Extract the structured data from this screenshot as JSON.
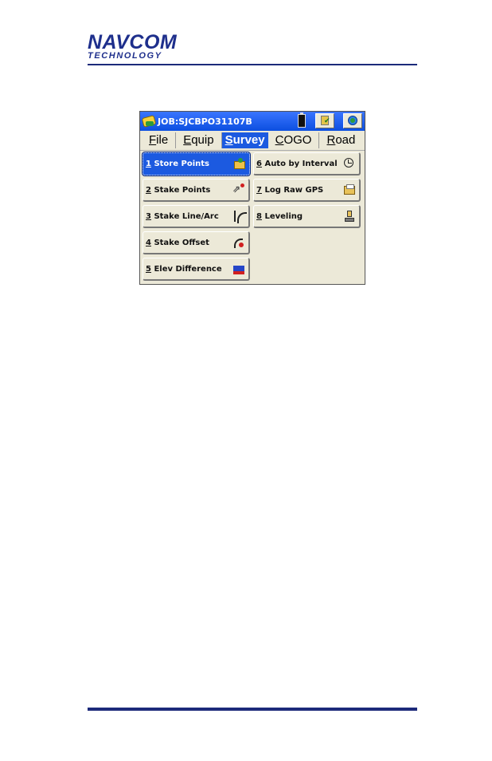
{
  "document": {
    "logo": {
      "line1": "NAVCOM",
      "line2": "TECHNOLOGY"
    }
  },
  "app": {
    "title": "JOB:SJCBPO31107B",
    "menu": [
      {
        "key": "F",
        "rest": "ile",
        "active": false
      },
      {
        "key": "E",
        "rest": "quip",
        "active": false
      },
      {
        "key": "S",
        "rest": "urvey",
        "active": true
      },
      {
        "key": "C",
        "rest": "OGO",
        "active": false
      },
      {
        "key": "R",
        "rest": "oad",
        "active": false
      }
    ],
    "buttons": {
      "b1": {
        "num": "1",
        "label": " Store Points",
        "icon": "folder-icon"
      },
      "b2": {
        "num": "2",
        "label": " Stake Points",
        "icon": "stake-points-icon"
      },
      "b3": {
        "num": "3",
        "label": " Stake Line/Arc",
        "icon": "line-arc-icon"
      },
      "b4": {
        "num": "4",
        "label": " Stake Offset",
        "icon": "offset-icon"
      },
      "b5": {
        "num": "5",
        "label": " Elev Difference",
        "icon": "elevation-icon"
      },
      "b6": {
        "num": "6",
        "label": " Auto by Interval",
        "icon": "clock-icon"
      },
      "b7": {
        "num": "7",
        "label": " Log Raw GPS",
        "icon": "log-icon"
      },
      "b8": {
        "num": "8",
        "label": " Leveling",
        "icon": "level-icon"
      }
    },
    "selected": "b1"
  }
}
